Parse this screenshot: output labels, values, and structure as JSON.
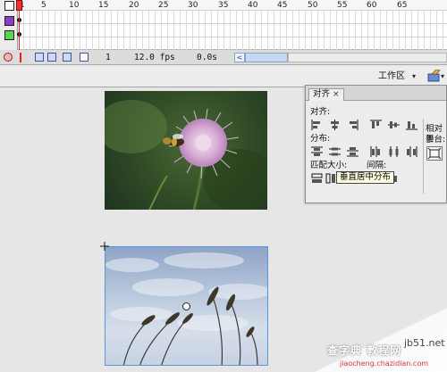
{
  "timeline": {
    "ruler_numbers": [
      "1",
      "5",
      "10",
      "15",
      "20",
      "25",
      "30",
      "35",
      "40",
      "45",
      "50",
      "55",
      "60",
      "65"
    ],
    "layers": [
      {
        "color": "#8b3fc9",
        "icon": "layer-color-square"
      },
      {
        "color": "#5ad35a",
        "icon": "layer-color-square"
      }
    ],
    "playhead_color": "#dd2222"
  },
  "status_bar": {
    "current_frame": "1",
    "frame_rate": "12.0 fps",
    "elapsed": "0.0s",
    "scroll_left_glyph": "<"
  },
  "edit_bar": {
    "workspace_label": "工作区",
    "caret_glyph": "▾"
  },
  "align_panel": {
    "tab_label": "对齐",
    "close_glyph": "×",
    "align_label": "对齐:",
    "distribute_label": "分布:",
    "match_size_label": "匹配大小:",
    "spacing_label": "间隔:",
    "relative_label": "相对于",
    "stage_label": "舞台:",
    "tooltip": "垂直居中分布"
  },
  "watermark": {
    "site": "jb51.net",
    "text": "查字典 教程网",
    "url": "jiaocheng.chazidian.com"
  },
  "colors": {
    "selection_border": "#5b94d8",
    "tooltip_bg": "#ffffe1"
  }
}
